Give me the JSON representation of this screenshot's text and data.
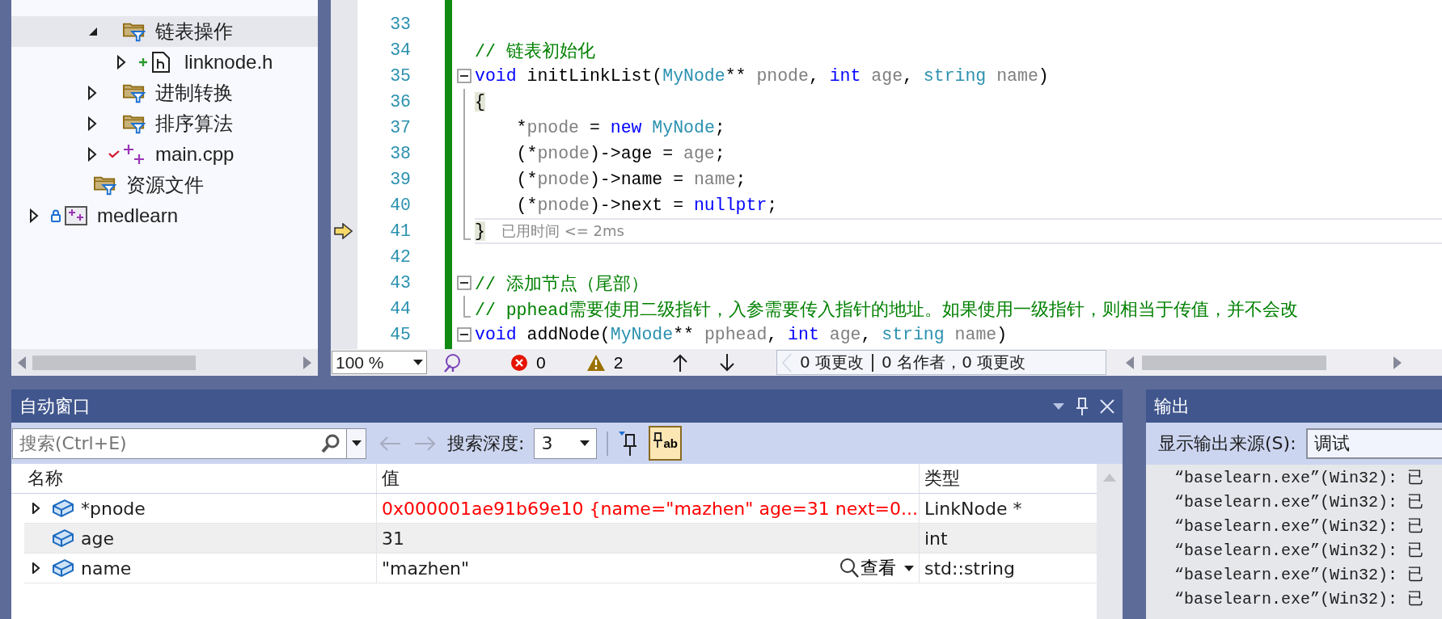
{
  "solution_explorer": {
    "tree": [
      {
        "children": [
          {
            "children": [
              {
                "label": "链表操作",
                "kind": "filter-folder",
                "expanded": true,
                "selected": true,
                "children": [
                  {
                    "label": "linknode.h",
                    "kind": "header",
                    "expanded": false,
                    "selected": false,
                    "added": true
                  }
                ]
              },
              {
                "label": "进制转换",
                "kind": "filter-folder",
                "expanded": false,
                "selected": false
              },
              {
                "label": "排序算法",
                "kind": "filter-folder",
                "expanded": false,
                "selected": false
              },
              {
                "label": "main.cpp",
                "kind": "cpp",
                "expanded": false,
                "selected": false,
                "checked_in": true
              }
            ]
          },
          {
            "label": "资源文件",
            "kind": "filter-folder",
            "selected": false
          }
        ]
      },
      {
        "label": "medlearn",
        "kind": "project",
        "expanded": false,
        "selected": false,
        "locked": true
      }
    ]
  },
  "editor": {
    "lines": [
      {
        "number": "33"
      },
      {
        "number": "34",
        "tokens": [
          {
            "t": "// 链表初始化",
            "kind": "comment"
          }
        ]
      },
      {
        "number": "35",
        "collapsible": true,
        "tokens": [
          {
            "t": "void",
            "kind": "keyword"
          },
          {
            "t": " initLinkList(",
            "kind": "plain"
          },
          {
            "t": "MyNode",
            "kind": "type"
          },
          {
            "t": "** ",
            "kind": "plain"
          },
          {
            "t": "pnode",
            "kind": "param"
          },
          {
            "t": ", ",
            "kind": "plain"
          },
          {
            "t": "int",
            "kind": "keyword"
          },
          {
            "t": " age",
            "kind": "param"
          },
          {
            "t": ", ",
            "kind": "plain"
          },
          {
            "t": "string",
            "kind": "type"
          },
          {
            "t": " name",
            "kind": "param"
          },
          {
            "t": ")",
            "kind": "plain"
          }
        ]
      },
      {
        "number": "36",
        "in_block": true,
        "tokens": [
          {
            "t": "{",
            "kind": "brace"
          }
        ]
      },
      {
        "number": "37",
        "in_block": true,
        "tokens": [
          {
            "t": "    *",
            "kind": "plain"
          },
          {
            "t": "pnode",
            "kind": "param"
          },
          {
            "t": " = ",
            "kind": "plain"
          },
          {
            "t": "new",
            "kind": "keyword"
          },
          {
            "t": " MyNode",
            "kind": "type"
          },
          {
            "t": ";",
            "kind": "plain"
          }
        ]
      },
      {
        "number": "38",
        "in_block": true,
        "tokens": [
          {
            "t": "    (*",
            "kind": "plain"
          },
          {
            "t": "pnode",
            "kind": "param"
          },
          {
            "t": ")->age = ",
            "kind": "plain"
          },
          {
            "t": "age",
            "kind": "param"
          },
          {
            "t": ";",
            "kind": "plain"
          }
        ]
      },
      {
        "number": "39",
        "in_block": true,
        "tokens": [
          {
            "t": "    (*",
            "kind": "plain"
          },
          {
            "t": "pnode",
            "kind": "param"
          },
          {
            "t": ")->name = ",
            "kind": "plain"
          },
          {
            "t": "name",
            "kind": "param"
          },
          {
            "t": ";",
            "kind": "plain"
          }
        ]
      },
      {
        "number": "40",
        "in_block": true,
        "tokens": [
          {
            "t": "    (*",
            "kind": "plain"
          },
          {
            "t": "pnode",
            "kind": "param"
          },
          {
            "t": ")->next = ",
            "kind": "plain"
          },
          {
            "t": "nullptr",
            "kind": "keyword"
          },
          {
            "t": ";",
            "kind": "plain"
          }
        ]
      },
      {
        "number": "41",
        "block_end": true,
        "current": true,
        "hint": "已用时间 <= 2ms",
        "tokens": [
          {
            "t": "}",
            "kind": "brace"
          }
        ]
      },
      {
        "number": "42"
      },
      {
        "number": "43",
        "collapsible": true,
        "tokens": [
          {
            "t": "// 添加节点（尾部）",
            "kind": "comment"
          }
        ]
      },
      {
        "number": "44",
        "block_end": true,
        "tokens": [
          {
            "t": "// pphead需要使用二级指针，入参需要传入指针的地址。如果使用一级指针，则相当于传值，并不会改",
            "kind": "comment"
          }
        ]
      },
      {
        "number": "45",
        "collapsible": true,
        "tokens": [
          {
            "t": "void",
            "kind": "keyword"
          },
          {
            "t": " addNode(",
            "kind": "plain"
          },
          {
            "t": "MyNode",
            "kind": "type"
          },
          {
            "t": "** ",
            "kind": "plain"
          },
          {
            "t": "pphead",
            "kind": "param"
          },
          {
            "t": ", ",
            "kind": "plain"
          },
          {
            "t": "int",
            "kind": "keyword"
          },
          {
            "t": " age",
            "kind": "param"
          },
          {
            "t": ", ",
            "kind": "plain"
          },
          {
            "t": "string",
            "kind": "type"
          },
          {
            "t": " name",
            "kind": "param"
          },
          {
            "t": ")",
            "kind": "plain"
          }
        ]
      }
    ],
    "status": {
      "zoom": "100 %",
      "errors": "0",
      "warnings": "2",
      "changes": "0 项更改",
      "authors": "0 名作者，0 项更改"
    }
  },
  "autos": {
    "title": "自动窗口",
    "search": {
      "placeholder": "搜索(Ctrl+E)"
    },
    "depth_label": "搜索深度:",
    "depth": "3",
    "toggle_text": "ab",
    "toggle_on": true,
    "columns": [
      "名称",
      "值",
      "类型"
    ],
    "rows": [
      {
        "name": "*pnode",
        "value": "0x000001ae91b69e10 {name=\"mazhen\" age=31 next=0...",
        "type": "LinkNode *",
        "expanded": false,
        "changed": true,
        "selected": false
      },
      {
        "name": "age",
        "value": "31",
        "type": "int",
        "changed": false,
        "selected": true
      },
      {
        "name": "name",
        "value": "\"mazhen\"",
        "type": "std::string",
        "expanded": false,
        "changed": false,
        "selected": false,
        "visualizer": "查看"
      }
    ]
  },
  "output": {
    "title": "输出",
    "source_label": "显示输出来源(S):",
    "source": "调试",
    "lines": [
      "“baselearn.exe”(Win32): 已",
      "“baselearn.exe”(Win32): 已",
      "“baselearn.exe”(Win32): 已",
      "“baselearn.exe”(Win32): 已",
      "“baselearn.exe”(Win32): 已",
      "“baselearn.exe”(Win32): 已"
    ]
  }
}
